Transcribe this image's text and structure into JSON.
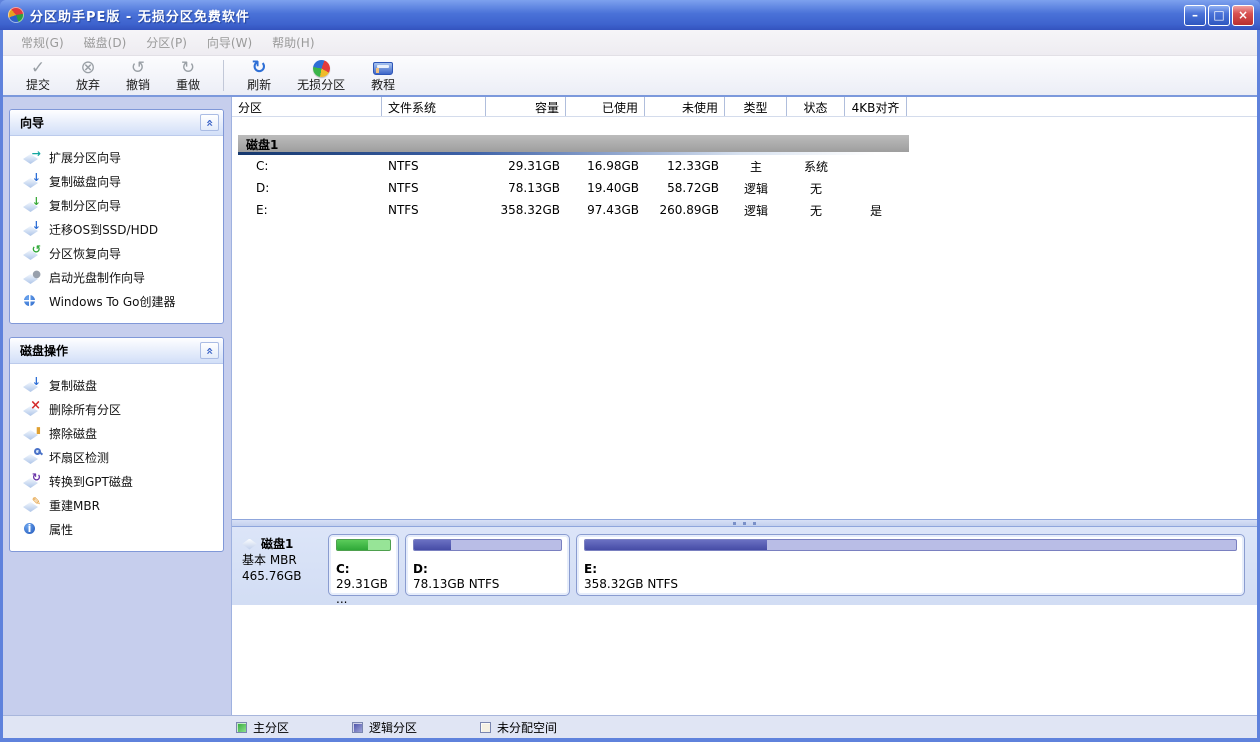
{
  "window": {
    "title": "分区助手PE版 - 无损分区免费软件",
    "minimize": "–",
    "maximize": "□",
    "close": "×"
  },
  "menu": {
    "items": [
      {
        "label": "常规(G)"
      },
      {
        "label": "磁盘(D)"
      },
      {
        "label": "分区(P)"
      },
      {
        "label": "向导(W)"
      },
      {
        "label": "帮助(H)"
      }
    ]
  },
  "toolbar": {
    "buttons": [
      {
        "label": "提交",
        "icon": "commit-check-icon"
      },
      {
        "label": "放弃",
        "icon": "discard-icon"
      },
      {
        "label": "撤销",
        "icon": "undo-icon"
      },
      {
        "label": "重做",
        "icon": "redo-icon"
      },
      {
        "label": "刷新",
        "icon": "refresh-icon"
      },
      {
        "label": "无损分区",
        "icon": "lossless-partition-pie-icon"
      },
      {
        "label": "教程",
        "icon": "tutorial-book-icon"
      }
    ]
  },
  "table": {
    "columns": [
      {
        "label": "分区"
      },
      {
        "label": "文件系统"
      },
      {
        "label": "容量"
      },
      {
        "label": "已使用"
      },
      {
        "label": "未使用"
      },
      {
        "label": "类型"
      },
      {
        "label": "状态"
      },
      {
        "label": "4KB对齐"
      }
    ],
    "disk_group": "磁盘1",
    "rows": [
      {
        "partition": "C:",
        "filesystem": "NTFS",
        "capacity": "29.31GB",
        "used": "16.98GB",
        "unused": "12.33GB",
        "type": "主",
        "status": "系统",
        "aligned_4kb": ""
      },
      {
        "partition": "D:",
        "filesystem": "NTFS",
        "capacity": "78.13GB",
        "used": "19.40GB",
        "unused": "58.72GB",
        "type": "逻辑",
        "status": "无",
        "aligned_4kb": ""
      },
      {
        "partition": "E:",
        "filesystem": "NTFS",
        "capacity": "358.32GB",
        "used": "97.43GB",
        "unused": "260.89GB",
        "type": "逻辑",
        "status": "无",
        "aligned_4kb": "是"
      }
    ]
  },
  "sidebar": {
    "wizards": {
      "title": "向导",
      "items": [
        {
          "label": "扩展分区向导",
          "icon": "extend-partition-icon"
        },
        {
          "label": "复制磁盘向导",
          "icon": "copy-disk-wizard-icon"
        },
        {
          "label": "复制分区向导",
          "icon": "copy-partition-wizard-icon"
        },
        {
          "label": "迁移OS到SSD/HDD",
          "icon": "migrate-os-icon"
        },
        {
          "label": "分区恢复向导",
          "icon": "partition-recovery-icon"
        },
        {
          "label": "启动光盘制作向导",
          "icon": "bootable-cd-icon"
        },
        {
          "label": "Windows To Go创建器",
          "icon": "windows-to-go-icon"
        }
      ]
    },
    "disk_ops": {
      "title": "磁盘操作",
      "items": [
        {
          "label": "复制磁盘",
          "icon": "copy-disk-icon"
        },
        {
          "label": "删除所有分区",
          "icon": "delete-all-partitions-icon"
        },
        {
          "label": "擦除磁盘",
          "icon": "wipe-disk-icon"
        },
        {
          "label": "坏扇区检测",
          "icon": "bad-sector-test-icon"
        },
        {
          "label": "转换到GPT磁盘",
          "icon": "convert-to-gpt-icon"
        },
        {
          "label": "重建MBR",
          "icon": "rebuild-mbr-icon"
        },
        {
          "label": "属性",
          "icon": "properties-icon"
        }
      ]
    }
  },
  "disk_view": {
    "disk": {
      "name": "磁盘1",
      "style": "基本 MBR",
      "capacity": "465.76GB"
    },
    "partitions": [
      {
        "name": "C:",
        "detail": "29.31GB ...",
        "kind": "primary",
        "used_pct": 58
      },
      {
        "name": "D:",
        "detail": "78.13GB NTFS",
        "kind": "logical",
        "used_pct": 25
      },
      {
        "name": "E:",
        "detail": "358.32GB NTFS",
        "kind": "logical",
        "used_pct": 28
      }
    ]
  },
  "statusbar": {
    "legend": [
      {
        "label": "主分区",
        "color": "linear-gradient(135deg,#2FA838,#8FE08F)"
      },
      {
        "label": "逻辑分区",
        "color": "linear-gradient(135deg,#464CA6,#9FA4D8)"
      },
      {
        "label": "未分配空间",
        "color": "#F5F1E4"
      }
    ]
  }
}
